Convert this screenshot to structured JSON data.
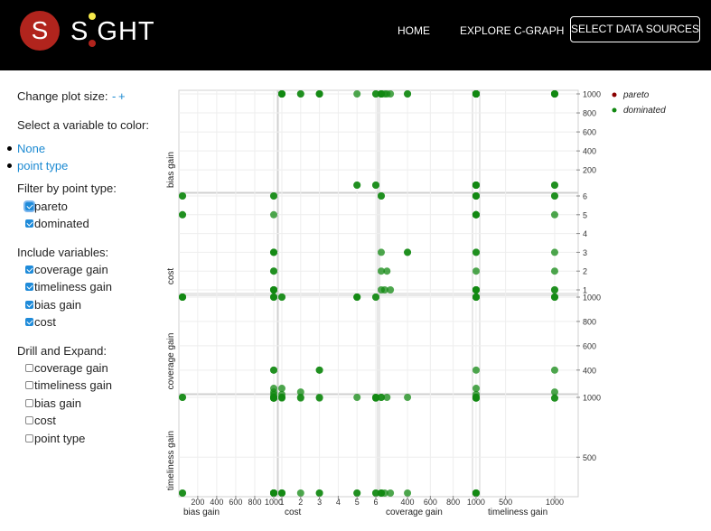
{
  "brand": {
    "logo_letter": "S",
    "wordmark": "S GHT"
  },
  "nav": {
    "home": "HOME",
    "explore": "EXPLORE C-GRAPH",
    "select_sources": "SELECT DATA SOURCES"
  },
  "sidebar": {
    "plot_size_label": "Change plot size:",
    "plot_size_minus": "-",
    "plot_size_plus": "+",
    "color_label": "Select a variable to color:",
    "color_options": [
      "None",
      "point type"
    ],
    "filter_label": "Filter by point type:",
    "filter_options": [
      {
        "label": "pareto",
        "checked": true
      },
      {
        "label": "dominated",
        "checked": true
      }
    ],
    "include_label": "Include variables:",
    "include_options": [
      {
        "label": "coverage gain",
        "checked": true
      },
      {
        "label": "timeliness gain",
        "checked": true
      },
      {
        "label": "bias gain",
        "checked": true
      },
      {
        "label": "cost",
        "checked": true
      }
    ],
    "drill_label": "Drill and Expand:",
    "drill_options": [
      {
        "label": "coverage gain",
        "checked": false
      },
      {
        "label": "timeliness gain",
        "checked": false
      },
      {
        "label": "bias gain",
        "checked": false
      },
      {
        "label": "cost",
        "checked": false
      },
      {
        "label": "point type",
        "checked": false
      }
    ]
  },
  "colors": {
    "pareto": "#8b0000",
    "dominated": "#118811",
    "nav_bg": "#000000",
    "link": "#1c8ad2"
  },
  "chart_data": {
    "type": "scatter",
    "variables": [
      "bias gain",
      "cost",
      "coverage gain",
      "timeliness gain"
    ],
    "axes": {
      "bias gain": {
        "ticks": [
          200,
          400,
          600,
          800,
          1000
        ]
      },
      "cost": {
        "ticks": [
          1,
          2,
          3,
          4,
          5,
          6
        ]
      },
      "coverage gain": {
        "ticks": [
          400,
          600,
          800,
          1000
        ]
      },
      "timeliness gain": {
        "ticks": [
          500,
          1000
        ]
      }
    },
    "legend": [
      {
        "name": "pareto",
        "color": "#8b0000"
      },
      {
        "name": "dominated",
        "color": "#118811"
      }
    ],
    "legend_position": "top-right",
    "points": [
      {
        "bias gain": 1000,
        "cost": 1,
        "coverage gain": 1000,
        "timeliness gain": 1000
      },
      {
        "bias gain": 1000,
        "cost": 2,
        "coverage gain": 220,
        "timeliness gain": 1000
      },
      {
        "bias gain": 1000,
        "cost": 3,
        "coverage gain": 400,
        "timeliness gain": 1000
      },
      {
        "bias gain": 1000,
        "cost": 6,
        "coverage gain": 170,
        "timeliness gain": 1000
      },
      {
        "bias gain": 1000,
        "cost": 1,
        "coverage gain": 170,
        "timeliness gain": 1000
      },
      {
        "bias gain": 1000,
        "cost": 1,
        "coverage gain": 1000,
        "timeliness gain": 200
      },
      {
        "bias gain": 1000,
        "cost": 2,
        "coverage gain": 170,
        "timeliness gain": 200
      },
      {
        "bias gain": 1000,
        "cost": 3,
        "coverage gain": 170,
        "timeliness gain": 200
      },
      {
        "bias gain": 1000,
        "cost": 3,
        "coverage gain": 400,
        "timeliness gain": 200
      },
      {
        "bias gain": 1000,
        "cost": 1,
        "coverage gain": 200,
        "timeliness gain": 200
      },
      {
        "bias gain": 1000,
        "cost": 1,
        "coverage gain": 250,
        "timeliness gain": 200
      },
      {
        "bias gain": 1000,
        "cost": 6,
        "coverage gain": 170,
        "timeliness gain": 200
      },
      {
        "bias gain": 1000,
        "cost": 5,
        "coverage gain": 1000,
        "timeliness gain": 200
      },
      {
        "bias gain": 40,
        "cost": 6,
        "coverage gain": 1000,
        "timeliness gain": 1000
      },
      {
        "bias gain": 40,
        "cost": 5,
        "coverage gain": 1000,
        "timeliness gain": 1000
      },
      {
        "bias gain": 40,
        "cost": 6,
        "coverage gain": 1000,
        "timeliness gain": 200
      },
      {
        "bias gain": 40,
        "cost": 5,
        "coverage gain": 1000,
        "timeliness gain": 200
      }
    ]
  }
}
